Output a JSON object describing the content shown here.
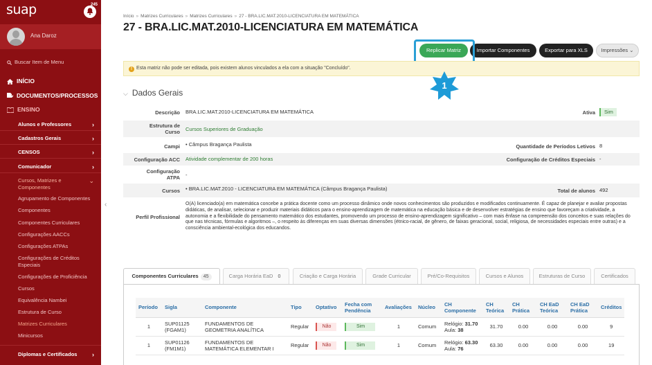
{
  "sidebar": {
    "logo": "suap",
    "notifications": "245",
    "user_name": "Ana Daroz",
    "search_placeholder": "Buscar Item de Menu",
    "main_items": [
      {
        "label": "INÍCIO"
      },
      {
        "label": "DOCUMENTOS/PROCESSOS"
      },
      {
        "label": "ENSINO"
      }
    ],
    "sub_items": [
      {
        "label": "Alunos e Professores"
      },
      {
        "label": "Cadastros Gerais"
      },
      {
        "label": "CENSOS"
      },
      {
        "label": "Comunicador"
      },
      {
        "label": "Cursos, Matrizes e Componentes"
      }
    ],
    "leaf_items": [
      {
        "label": "Agrupamento de Componentes"
      },
      {
        "label": "Componentes"
      },
      {
        "label": "Componentes Curriculares"
      },
      {
        "label": "Configurações AACCs"
      },
      {
        "label": "Configurações ATPAs"
      },
      {
        "label": "Configurações de Créditos Especiais"
      },
      {
        "label": "Configurações de Proficiência"
      },
      {
        "label": "Cursos"
      },
      {
        "label": "Equivalência Nambei"
      },
      {
        "label": "Estrutura de Curso"
      },
      {
        "label": "Matrizes Curriculares"
      },
      {
        "label": "Minicursos"
      }
    ],
    "bottom_item": "Diplomas e Certificados"
  },
  "breadcrumb": [
    "Início",
    "Matrizes Curriculares",
    "Matrizes Curriculares",
    "27 - BRA.LIC.MAT.2010-LICENCIATURA EM MATEMÁTICA"
  ],
  "page_title": "27 - BRA.LIC.MAT.2010-LICENCIATURA EM MATEMÁTICA",
  "toolbar": {
    "replicar": "Replicar Matriz",
    "importar": "Importar Componentes",
    "exportar": "Exportar para XLS",
    "impressoes": "Impressões"
  },
  "alert_text": "Esta matriz não pode ser editada, pois existem alunos vinculados a ela com a situação \"Concluído\".",
  "step_number": "1",
  "section_title": "Dados Gerais",
  "details": {
    "descricao_label": "Descrição",
    "descricao": "BRA.LIC.MAT.2010-LICENCIATURA EM MATEMÁTICA",
    "ativa_label": "Ativa",
    "ativa": "Sim",
    "estrutura_label": "Estrutura de Curso",
    "estrutura": "Cursos Superiores de Graduação",
    "campi_label": "Campi",
    "campi": "Câmpus Bragança Paulista",
    "periodos_label": "Quantidade de Períodos Letivos",
    "periodos": "8",
    "acc_label": "Configuração ACC",
    "acc": "Atividade complementar de 200 horas",
    "creditos_label": "Configuração de Créditos Especiais",
    "creditos": "-",
    "atpa_label": "Configuração ATPA",
    "atpa": "-",
    "cursos_label": "Cursos",
    "cursos": "BRA.LIC.MAT.2010 - LICENCIATURA EM MATEMÁTICA (Câmpus Bragança Paulista)",
    "total_label": "Total de alunos",
    "total": "492",
    "perfil_label": "Perfil Profissional",
    "perfil": "O(A) licenciado(a) em matemática concebe a prática docente como um processo dinâmico onde novos conhecimentos são produzidos e modificados continuamente. É capaz de planejar e avaliar propostas didáticas, de analisar, selecionar e produzir materiais didáticos para o ensino-aprendizagem de matemática na educação básica e de desenvolver estratégias de ensino que favoreçam a criatividade, a autonomia e a flexibilidade do pensamento matemático dos estudantes, promovendo um processo de ensino-aprendizagem significativo – com mais ênfase na compreensão dos conceitos e suas relações do que nas técnicas, fórmulas e algoritmos –, o respeito às diferenças em suas diversas dimensões (étnico-racial, de gênero, de faixas geracional, social, religiosa, de necessidades especiais entre outras) e a consciência ambiental-ecológica dos educandos."
  },
  "tabs": [
    {
      "label": "Componentes Curriculares",
      "count": "45"
    },
    {
      "label": "Carga Horária EaD",
      "count": "0"
    },
    {
      "label": "Criação e Carga Horária"
    },
    {
      "label": "Grade Curricular"
    },
    {
      "label": "Pré/Co-Requisitos"
    },
    {
      "label": "Cursos e Alunos"
    },
    {
      "label": "Estruturas de Curso"
    },
    {
      "label": "Certificados"
    }
  ],
  "table": {
    "headers": [
      "Período",
      "Sigla",
      "Componente",
      "Tipo",
      "Optativo",
      "Fecha com Pendência",
      "Avaliações",
      "Núcleo",
      "CH Componente",
      "CH Teórica",
      "CH Prática",
      "CH EaD Teórica",
      "CH EaD Prática",
      "Créditos"
    ],
    "rows": [
      {
        "periodo": "1",
        "sigla": "SUP01125 (FGAM1)",
        "componente": "FUNDAMENTOS DE GEOMETRIA ANALÍTICA",
        "tipo": "Regular",
        "optativo": "Não",
        "pendencia": "Sim",
        "avaliacoes": "1",
        "nucleo": "Comum",
        "ch_relogio_label": "Relógio:",
        "ch_relogio": "31.70",
        "ch_aula_label": "Aula:",
        "ch_aula": "38",
        "teorica": "31.70",
        "pratica": "0.00",
        "ead_teorica": "0.00",
        "ead_pratica": "0.00",
        "creditos": "9"
      },
      {
        "periodo": "1",
        "sigla": "SUP01126 (FM1M1)",
        "componente": "FUNDAMENTOS DE MATEMÁTICA ELEMENTAR I",
        "tipo": "Regular",
        "optativo": "Não",
        "pendencia": "Sim",
        "avaliacoes": "1",
        "nucleo": "Comum",
        "ch_relogio_label": "Relógio:",
        "ch_relogio": "63.30",
        "ch_aula_label": "Aula:",
        "ch_aula": "76",
        "teorica": "63.30",
        "pratica": "0.00",
        "ead_teorica": "0.00",
        "ead_pratica": "0.00",
        "creditos": "19"
      }
    ]
  },
  "colors": {
    "sidebar": "#8c0f13",
    "accent_green": "#3aa757",
    "highlight_blue": "#2a9fd6"
  }
}
